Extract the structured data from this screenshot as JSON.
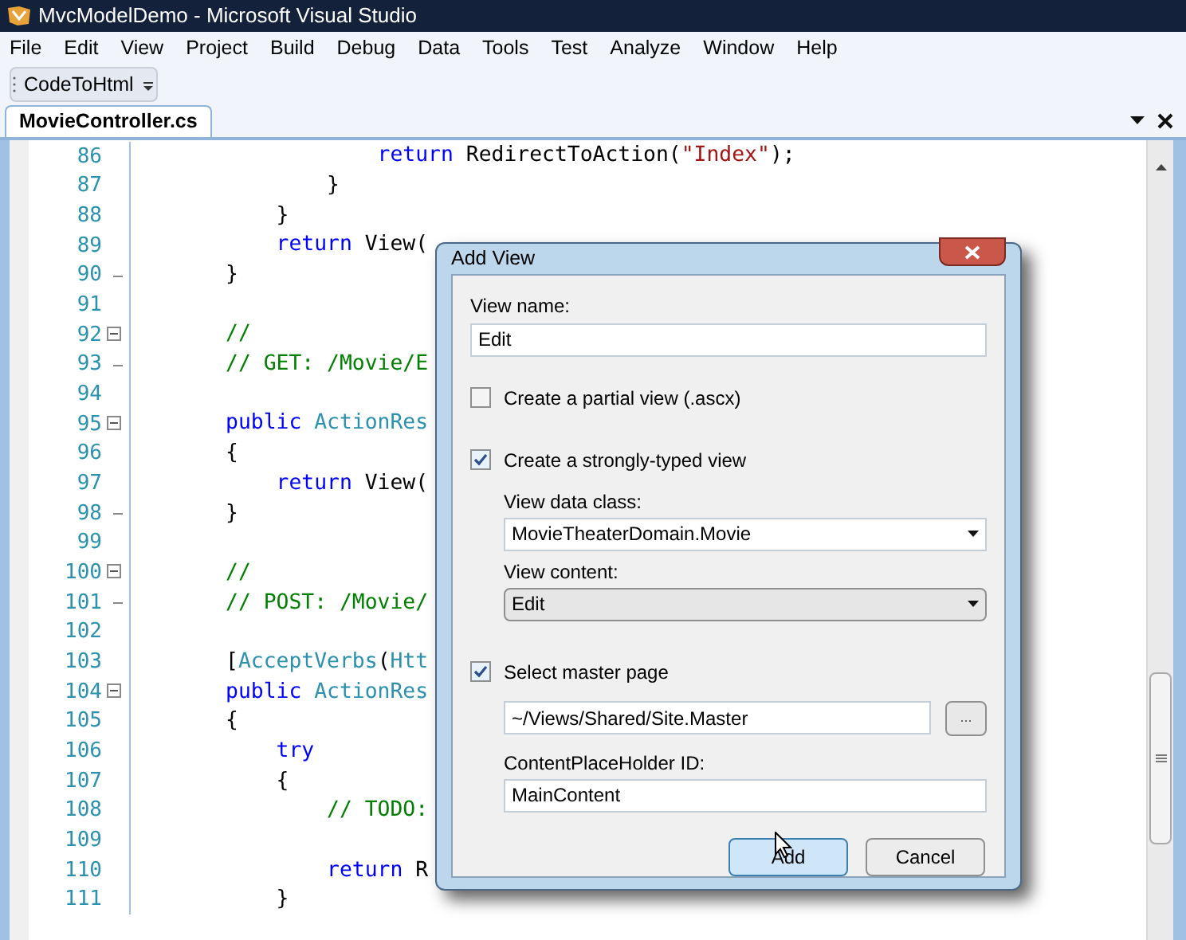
{
  "window": {
    "title": "MvcModelDemo - Microsoft Visual Studio"
  },
  "menu": [
    "File",
    "Edit",
    "View",
    "Project",
    "Build",
    "Debug",
    "Data",
    "Tools",
    "Test",
    "Analyze",
    "Window",
    "Help"
  ],
  "toolbar": {
    "button": "CodeToHtml"
  },
  "tabs": [
    {
      "label": "MovieController.cs",
      "selected": true
    }
  ],
  "code_lines": [
    {
      "number": "86",
      "tokens": [
        {
          "kind": "keyword",
          "text": "                    return"
        },
        {
          "kind": "plain",
          "text": " RedirectToAction("
        },
        {
          "kind": "string",
          "text": "\"Index\""
        },
        {
          "kind": "plain",
          "text": ");"
        }
      ]
    },
    {
      "number": "87",
      "tokens": [
        {
          "kind": "plain",
          "text": "                }"
        }
      ]
    },
    {
      "number": "88",
      "tokens": [
        {
          "kind": "plain",
          "text": "            }"
        }
      ]
    },
    {
      "number": "89",
      "tokens": [
        {
          "kind": "keyword",
          "text": "            return"
        },
        {
          "kind": "plain",
          "text": " View("
        }
      ]
    },
    {
      "number": "90",
      "fold_end": true,
      "tokens": [
        {
          "kind": "plain",
          "text": "        }"
        }
      ]
    },
    {
      "number": "91"
    },
    {
      "number": "92",
      "expanded": true,
      "tokens": [
        {
          "kind": "comment",
          "text": "        //"
        }
      ]
    },
    {
      "number": "93",
      "fold_end": true,
      "tokens": [
        {
          "kind": "comment",
          "text": "        // GET: /Movie/E"
        }
      ]
    },
    {
      "number": "94"
    },
    {
      "number": "95",
      "expanded": true,
      "tokens": [
        {
          "kind": "keyword",
          "text": "        public"
        },
        {
          "kind": "type",
          "text": " ActionRes"
        }
      ]
    },
    {
      "number": "96",
      "tokens": [
        {
          "kind": "plain",
          "text": "        {"
        }
      ]
    },
    {
      "number": "97",
      "tokens": [
        {
          "kind": "keyword",
          "text": "            return"
        },
        {
          "kind": "plain",
          "text": " View("
        }
      ]
    },
    {
      "number": "98",
      "fold_end": true,
      "tokens": [
        {
          "kind": "plain",
          "text": "        }"
        }
      ]
    },
    {
      "number": "99"
    },
    {
      "number": "100",
      "expanded": true,
      "tokens": [
        {
          "kind": "comment",
          "text": "        //"
        }
      ]
    },
    {
      "number": "101",
      "fold_end": true,
      "tokens": [
        {
          "kind": "comment",
          "text": "        // POST: /Movie/"
        }
      ]
    },
    {
      "number": "102"
    },
    {
      "number": "103",
      "tokens": [
        {
          "kind": "plain",
          "text": "        ["
        },
        {
          "kind": "type",
          "text": "AcceptVerbs"
        },
        {
          "kind": "plain",
          "text": "("
        },
        {
          "kind": "type",
          "text": "Htt"
        }
      ]
    },
    {
      "number": "104",
      "expanded": true,
      "tokens": [
        {
          "kind": "keyword",
          "text": "        public"
        },
        {
          "kind": "type",
          "text": " ActionRes"
        }
      ]
    },
    {
      "number": "105",
      "tokens": [
        {
          "kind": "plain",
          "text": "        {"
        }
      ]
    },
    {
      "number": "106",
      "tokens": [
        {
          "kind": "keyword",
          "text": "            try"
        }
      ]
    },
    {
      "number": "107",
      "tokens": [
        {
          "kind": "plain",
          "text": "            {"
        }
      ]
    },
    {
      "number": "108",
      "tokens": [
        {
          "kind": "comment",
          "text": "                // TODO:"
        }
      ]
    },
    {
      "number": "109"
    },
    {
      "number": "110",
      "tokens": [
        {
          "kind": "keyword",
          "text": "                return"
        },
        {
          "kind": "plain",
          "text": " R"
        }
      ]
    },
    {
      "number": "111",
      "tokens": [
        {
          "kind": "plain",
          "text": "            }"
        }
      ]
    }
  ],
  "dialog": {
    "title": "Add View",
    "view_name": {
      "label": "View name:",
      "value": "Edit"
    },
    "partial_view": {
      "label": "Create a partial view (.ascx)",
      "checked": false
    },
    "strongly_typed": {
      "label": "Create a strongly-typed view",
      "checked": true
    },
    "view_data_class": {
      "label": "View data class:",
      "value": "MovieTheaterDomain.Movie"
    },
    "view_content": {
      "label": "View content:",
      "value": "Edit"
    },
    "master_page": {
      "label": "Select master page",
      "checked": true,
      "value": "~/Views/Shared/Site.Master",
      "browse": "..."
    },
    "placeholder_id": {
      "label": "ContentPlaceHolder ID:",
      "value": "MainContent"
    },
    "buttons": [
      {
        "label": "Add",
        "selected": true
      },
      {
        "label": "Cancel",
        "selected": false
      }
    ]
  }
}
